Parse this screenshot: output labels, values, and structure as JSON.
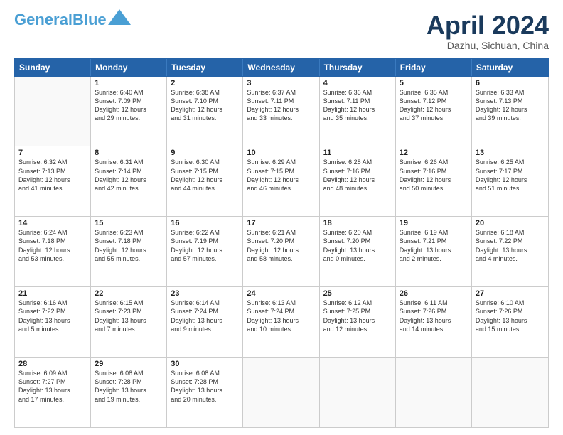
{
  "header": {
    "logo_line1": "General",
    "logo_line2": "Blue",
    "month": "April 2024",
    "location": "Dazhu, Sichuan, China"
  },
  "weekdays": [
    "Sunday",
    "Monday",
    "Tuesday",
    "Wednesday",
    "Thursday",
    "Friday",
    "Saturday"
  ],
  "weeks": [
    [
      {
        "day": "",
        "info": ""
      },
      {
        "day": "1",
        "info": "Sunrise: 6:40 AM\nSunset: 7:09 PM\nDaylight: 12 hours\nand 29 minutes."
      },
      {
        "day": "2",
        "info": "Sunrise: 6:38 AM\nSunset: 7:10 PM\nDaylight: 12 hours\nand 31 minutes."
      },
      {
        "day": "3",
        "info": "Sunrise: 6:37 AM\nSunset: 7:11 PM\nDaylight: 12 hours\nand 33 minutes."
      },
      {
        "day": "4",
        "info": "Sunrise: 6:36 AM\nSunset: 7:11 PM\nDaylight: 12 hours\nand 35 minutes."
      },
      {
        "day": "5",
        "info": "Sunrise: 6:35 AM\nSunset: 7:12 PM\nDaylight: 12 hours\nand 37 minutes."
      },
      {
        "day": "6",
        "info": "Sunrise: 6:33 AM\nSunset: 7:13 PM\nDaylight: 12 hours\nand 39 minutes."
      }
    ],
    [
      {
        "day": "7",
        "info": "Sunrise: 6:32 AM\nSunset: 7:13 PM\nDaylight: 12 hours\nand 41 minutes."
      },
      {
        "day": "8",
        "info": "Sunrise: 6:31 AM\nSunset: 7:14 PM\nDaylight: 12 hours\nand 42 minutes."
      },
      {
        "day": "9",
        "info": "Sunrise: 6:30 AM\nSunset: 7:15 PM\nDaylight: 12 hours\nand 44 minutes."
      },
      {
        "day": "10",
        "info": "Sunrise: 6:29 AM\nSunset: 7:15 PM\nDaylight: 12 hours\nand 46 minutes."
      },
      {
        "day": "11",
        "info": "Sunrise: 6:28 AM\nSunset: 7:16 PM\nDaylight: 12 hours\nand 48 minutes."
      },
      {
        "day": "12",
        "info": "Sunrise: 6:26 AM\nSunset: 7:16 PM\nDaylight: 12 hours\nand 50 minutes."
      },
      {
        "day": "13",
        "info": "Sunrise: 6:25 AM\nSunset: 7:17 PM\nDaylight: 12 hours\nand 51 minutes."
      }
    ],
    [
      {
        "day": "14",
        "info": "Sunrise: 6:24 AM\nSunset: 7:18 PM\nDaylight: 12 hours\nand 53 minutes."
      },
      {
        "day": "15",
        "info": "Sunrise: 6:23 AM\nSunset: 7:18 PM\nDaylight: 12 hours\nand 55 minutes."
      },
      {
        "day": "16",
        "info": "Sunrise: 6:22 AM\nSunset: 7:19 PM\nDaylight: 12 hours\nand 57 minutes."
      },
      {
        "day": "17",
        "info": "Sunrise: 6:21 AM\nSunset: 7:20 PM\nDaylight: 12 hours\nand 58 minutes."
      },
      {
        "day": "18",
        "info": "Sunrise: 6:20 AM\nSunset: 7:20 PM\nDaylight: 13 hours\nand 0 minutes."
      },
      {
        "day": "19",
        "info": "Sunrise: 6:19 AM\nSunset: 7:21 PM\nDaylight: 13 hours\nand 2 minutes."
      },
      {
        "day": "20",
        "info": "Sunrise: 6:18 AM\nSunset: 7:22 PM\nDaylight: 13 hours\nand 4 minutes."
      }
    ],
    [
      {
        "day": "21",
        "info": "Sunrise: 6:16 AM\nSunset: 7:22 PM\nDaylight: 13 hours\nand 5 minutes."
      },
      {
        "day": "22",
        "info": "Sunrise: 6:15 AM\nSunset: 7:23 PM\nDaylight: 13 hours\nand 7 minutes."
      },
      {
        "day": "23",
        "info": "Sunrise: 6:14 AM\nSunset: 7:24 PM\nDaylight: 13 hours\nand 9 minutes."
      },
      {
        "day": "24",
        "info": "Sunrise: 6:13 AM\nSunset: 7:24 PM\nDaylight: 13 hours\nand 10 minutes."
      },
      {
        "day": "25",
        "info": "Sunrise: 6:12 AM\nSunset: 7:25 PM\nDaylight: 13 hours\nand 12 minutes."
      },
      {
        "day": "26",
        "info": "Sunrise: 6:11 AM\nSunset: 7:26 PM\nDaylight: 13 hours\nand 14 minutes."
      },
      {
        "day": "27",
        "info": "Sunrise: 6:10 AM\nSunset: 7:26 PM\nDaylight: 13 hours\nand 15 minutes."
      }
    ],
    [
      {
        "day": "28",
        "info": "Sunrise: 6:09 AM\nSunset: 7:27 PM\nDaylight: 13 hours\nand 17 minutes."
      },
      {
        "day": "29",
        "info": "Sunrise: 6:08 AM\nSunset: 7:28 PM\nDaylight: 13 hours\nand 19 minutes."
      },
      {
        "day": "30",
        "info": "Sunrise: 6:08 AM\nSunset: 7:28 PM\nDaylight: 13 hours\nand 20 minutes."
      },
      {
        "day": "",
        "info": ""
      },
      {
        "day": "",
        "info": ""
      },
      {
        "day": "",
        "info": ""
      },
      {
        "day": "",
        "info": ""
      }
    ]
  ]
}
